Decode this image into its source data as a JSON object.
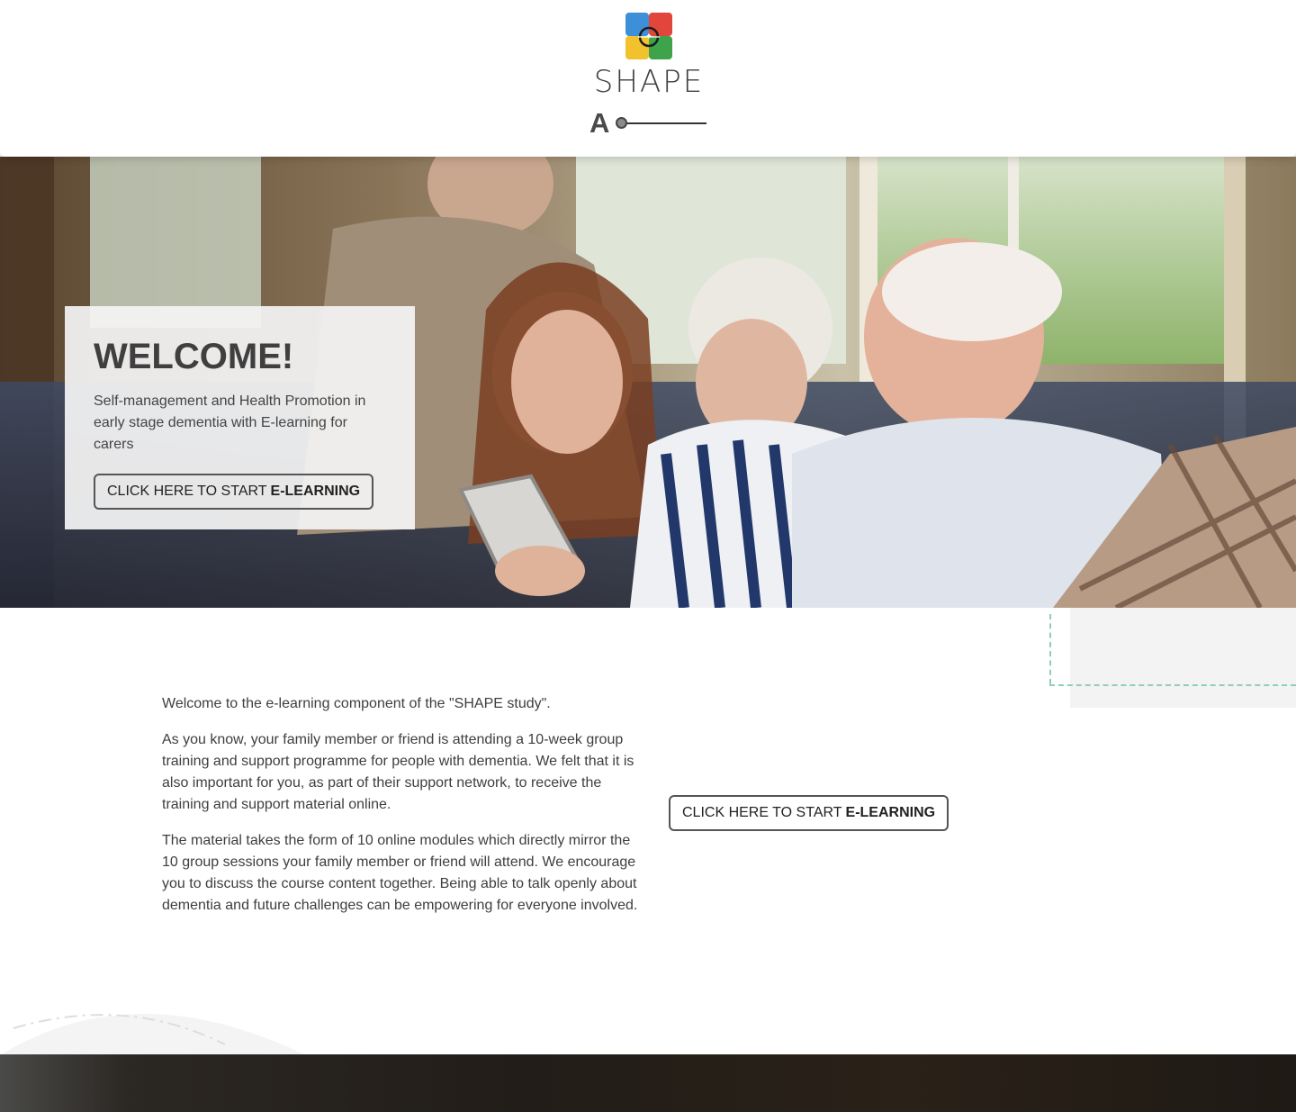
{
  "header": {
    "logo_text": "SHAPE",
    "font_size_label": "A"
  },
  "hero": {
    "title": "WELCOME!",
    "subtitle": "Self-management and Health Promotion in early stage dementia with E-learning for carers",
    "cta_prefix": "CLICK HERE TO START",
    "cta_bold": "E-LEARNING"
  },
  "main": {
    "paragraphs": [
      "Welcome to the e-learning component of the \"SHAPE study\".",
      "As you know, your family member or friend is attending a 10-week group training and support programme for people with dementia. We felt that it is also important for you, as part of their support network, to receive the training and support material online.",
      "The material takes the form of 10 online modules which directly mirror the 10 group sessions your family member or friend will attend. We encourage you to discuss the course content together. Being able to talk openly about dementia and future challenges can be empowering for everyone involved."
    ],
    "cta_prefix": "CLICK HERE TO START",
    "cta_bold": "E-LEARNING"
  },
  "colors": {
    "logo_blue": "#3d8fd8",
    "logo_red": "#e2453a",
    "logo_yellow": "#f2c12e",
    "logo_green": "#3ea34a",
    "accent_dash": "#8fd0b5"
  }
}
